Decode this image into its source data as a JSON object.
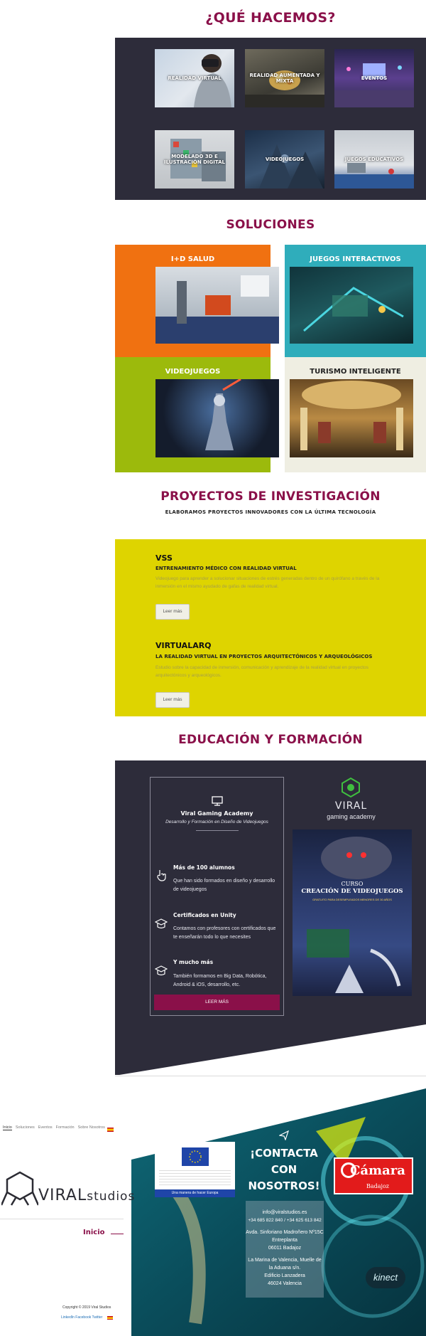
{
  "que_hacemos": {
    "title": "¿QUÉ HACEMOS?",
    "items": [
      {
        "label": "REALIDAD VIRTUAL"
      },
      {
        "label": "REALIDAD AUMENTADA Y MIXTA"
      },
      {
        "label": "EVENTOS"
      },
      {
        "label": "MODELADO 3D E ILUSTRACIÓN DIGITAL"
      },
      {
        "label": "VIDEOJUEGOS"
      },
      {
        "label": "JUEGOS EDUCATIVOS"
      }
    ]
  },
  "soluciones": {
    "title": "SOLUCIONES",
    "items": [
      {
        "label": "I+D SALUD",
        "color": "#f07111"
      },
      {
        "label": "JUEGOS INTERACTIVOS",
        "color": "#2fadbb"
      },
      {
        "label": "VIDEOJUEGOS",
        "color": "#9cba0c"
      },
      {
        "label": "TURISMO INTELIGENTE",
        "color": "#efeee2"
      }
    ]
  },
  "proyectos": {
    "title": "PROYECTOS DE INVESTIGACIÓN",
    "subtitle": "ELABORAMOS PROYECTOS INNOVADORES CON LA ÚLTIMA TECNOLOGÍA",
    "items": [
      {
        "name": "VSS",
        "subtitle": "ENTRENAMIENTO MÉDICO CON REALIDAD VIRTUAL",
        "description": "Videojuego para aprender a solucionar situaciones de estrés generadas dentro de un quirófano a través de la inmersión en el mismo ayudado de gafas de realidad virtual.",
        "button": "Leer más"
      },
      {
        "name": "VIRTUALARQ",
        "subtitle": "LA REALIDAD VIRTUAL EN PROYECTOS ARQUITECTÓNICOS Y ARQUEOLÓGICOS",
        "description": "Estudio sobre la capacidad de inmersión, comunicación y aprendizaje de la realidad virtual en proyectos arquitectónicos y arqueológicos.",
        "button": "Leer más"
      }
    ]
  },
  "educacion": {
    "title": "EDUCACIÓN Y FORMACIÓN",
    "card_title": "Viral Gaming Academy",
    "card_subtitle": "Desarrollo y Formación en Diseño de Videojuegos",
    "features": [
      {
        "title": "Más de 100 alumnos",
        "text": "Que han sido formados en diseño y desarrollo de videojuegos"
      },
      {
        "title": "Certificados en Unity",
        "text": "Contamos con profesores con certificados que te enseñarán todo lo que necesites"
      },
      {
        "title": "Y mucho más",
        "text": "También formamos en Big Data, Robótica, Android & iOS, desarrollo, etc."
      }
    ],
    "button": "LEER MÁS",
    "logo_name": "VIRAL",
    "logo_sub": "gaming academy",
    "poster": {
      "curso": "CURSO",
      "headline": "CREACIÓN DE VIDEOJUEGOS",
      "note": "GRATUITO PARA DESEMPLEADOS MENORES DE 30 AÑOS"
    }
  },
  "footer": {
    "nav": [
      "Inicio",
      "Soluciones",
      "Eventos",
      "Formación",
      "Sobre Nosotros"
    ],
    "brand_a": "VIRAL",
    "brand_b": "studios",
    "inicio": "Inicio",
    "copyright": "Copyright © 2019 Viral Studios",
    "social": "LinkedIn Facebook Twitter",
    "eu_caption": "Una manera de hacer Europa",
    "contact_title": "¡CONTACTA CON NOSOTROS!",
    "email": "info@viralstudios.es",
    "phones": "+34 685 822 840 / +34 625 613 842",
    "address1": [
      "Avda. Sinforiano Madroñero Nº15C",
      "Entreplanta",
      "06011 Badajoz"
    ],
    "address2": [
      "La Marina de Valencia, Muelle de la Aduana s/n.",
      "Edificio Lanzadera",
      "46024 Valencia"
    ],
    "camara_name": "Cámara",
    "camara_city": "Badajoz",
    "kinect": "kinect"
  }
}
